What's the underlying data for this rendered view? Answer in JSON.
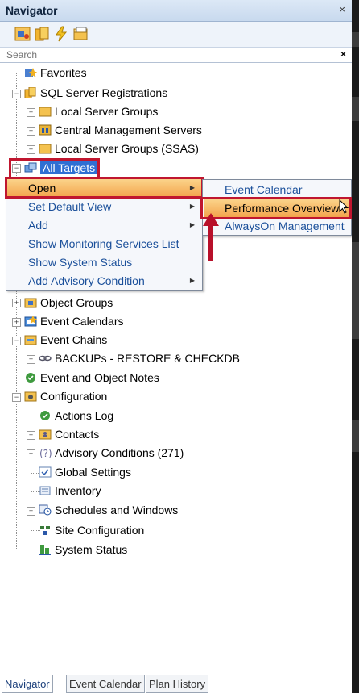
{
  "window": {
    "title": "Navigator",
    "close_glyph": "×"
  },
  "toolbar": {
    "icons": [
      "server-icon",
      "group-icon",
      "lightning-icon",
      "folder-icon"
    ]
  },
  "search": {
    "placeholder": "Search",
    "clear_glyph": "×"
  },
  "tree": {
    "favorites": "Favorites",
    "sql_server_registrations": "SQL Server Registrations",
    "local_server_groups": "Local Server Groups",
    "central_management_servers": "Central Management Servers",
    "local_server_groups_ssas": "Local Server Groups (SSAS)",
    "all_targets": "All Targets",
    "object_groups": "Object Groups",
    "event_calendars": "Event Calendars",
    "event_chains": "Event Chains",
    "backups_restore": "BACKUPs - RESTORE & CHECKDB",
    "event_object_notes": "Event and Object Notes",
    "configuration": "Configuration",
    "actions_log": "Actions Log",
    "contacts": "Contacts",
    "advisory_conditions": "Advisory Conditions (271)",
    "global_settings": "Global Settings",
    "inventory": "Inventory",
    "schedules_windows": "Schedules and Windows",
    "site_configuration": "Site Configuration",
    "system_status": "System Status"
  },
  "context_menu": {
    "items": [
      "Open",
      "Set Default View",
      "Add",
      "Show Monitoring Services List",
      "Show System Status",
      "Add Advisory Condition"
    ]
  },
  "submenu": {
    "items": [
      "Event Calendar",
      "Performance Overview",
      "AlwaysOn Management"
    ]
  },
  "bottom_tabs": [
    "Navigator",
    "Event Calendar",
    "Plan History"
  ],
  "colors": {
    "highlight_red": "#c0162f",
    "selection_blue": "#2f6fd3",
    "menu_text": "#1a4f9a"
  }
}
